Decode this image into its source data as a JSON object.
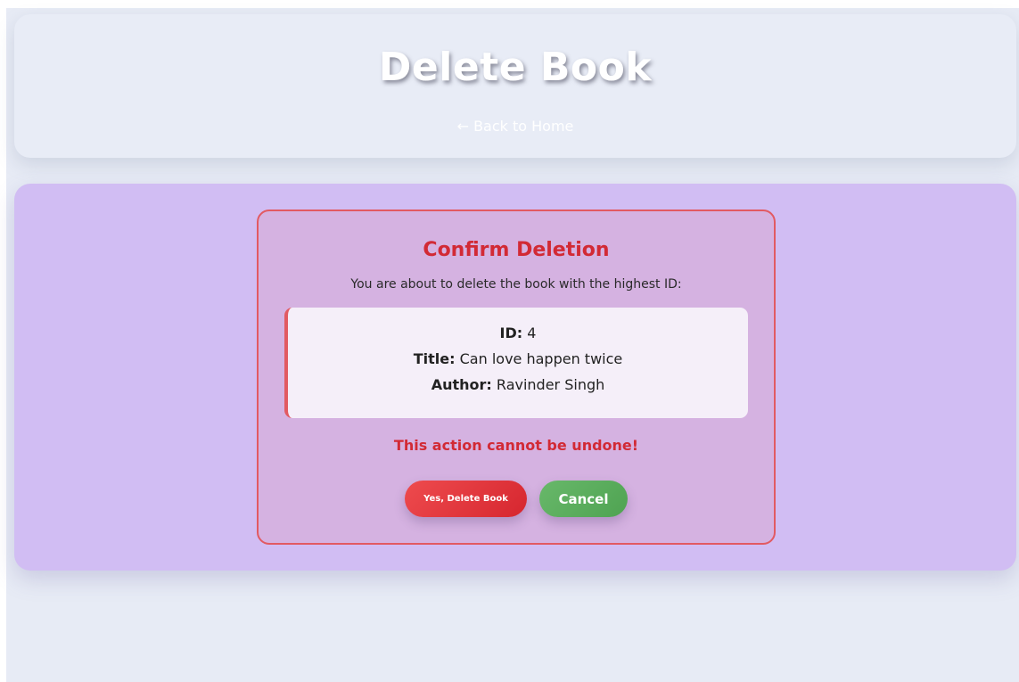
{
  "header": {
    "title": "Delete Book",
    "back_link": "← Back to Home"
  },
  "confirm": {
    "title": "Confirm Deletion",
    "subtitle": "You are about to delete the book with the highest ID:",
    "book": {
      "id_label": "ID:",
      "id_value": "4",
      "title_label": "Title:",
      "title_value": "Can love happen twice",
      "author_label": "Author:",
      "author_value": "Ravinder Singh"
    },
    "warning": "This action cannot be undone!",
    "delete_label": "Yes, Delete Book",
    "cancel_label": "Cancel"
  },
  "colors": {
    "page_background": "#e7ebf5",
    "panel_background": "#d1bdf3",
    "danger": "#d22a35",
    "confirm_border": "#e25a62",
    "success": "#5cac5e"
  }
}
